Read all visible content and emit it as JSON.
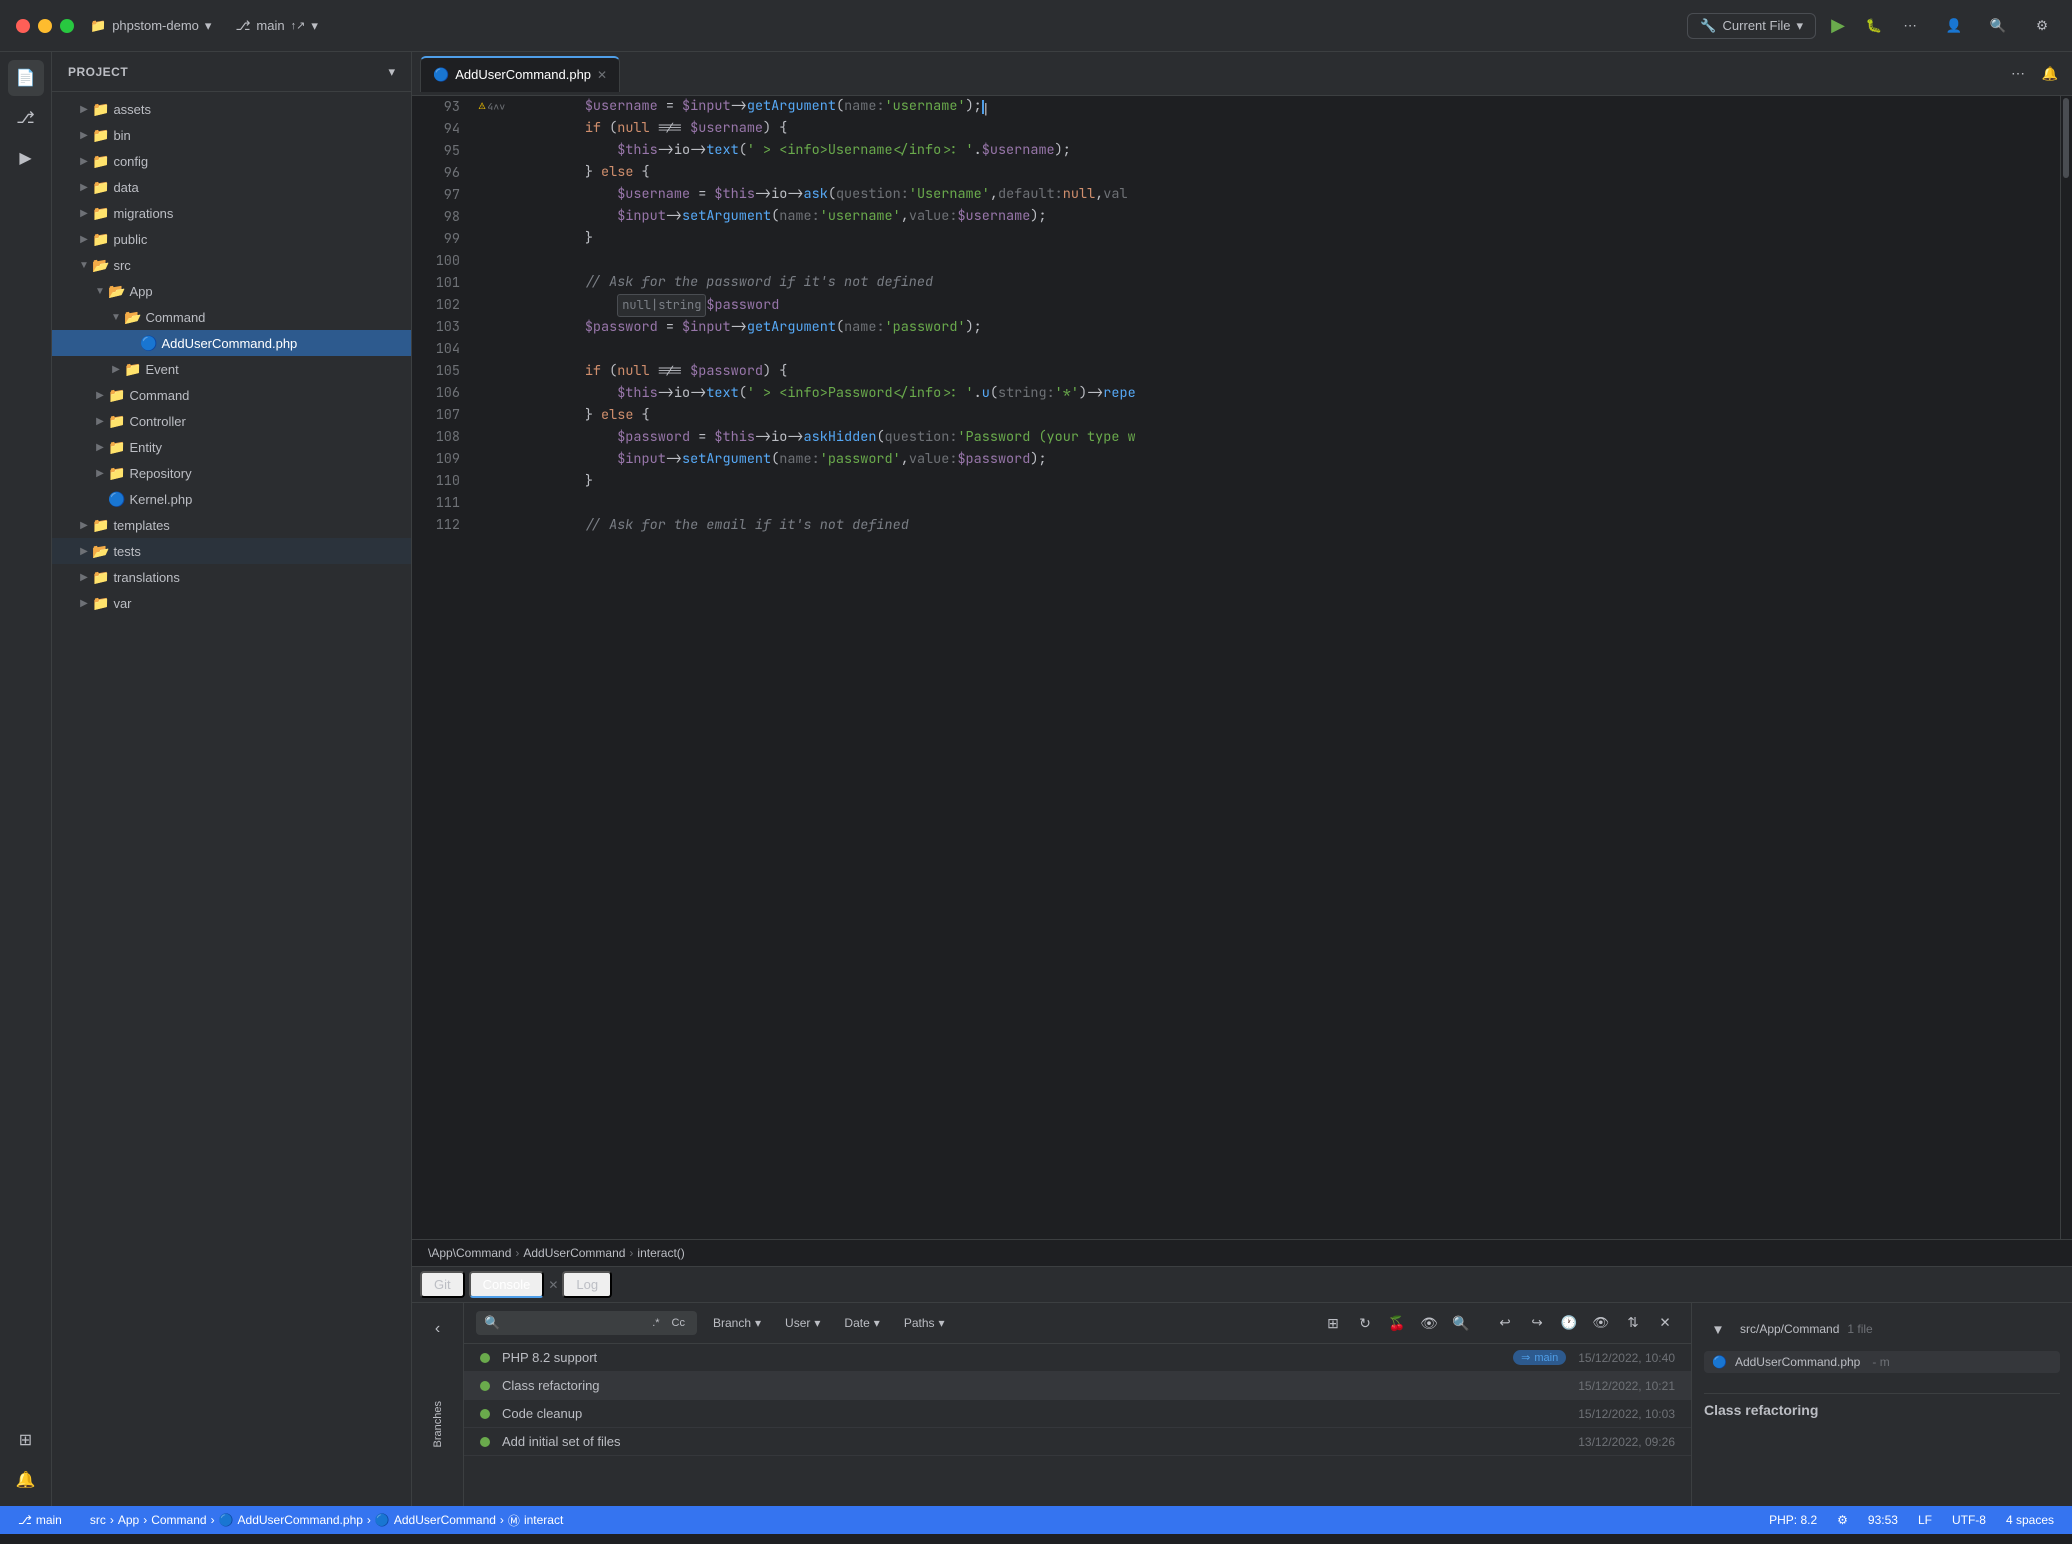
{
  "titlebar": {
    "traffic_close": "●",
    "traffic_min": "●",
    "traffic_max": "●",
    "project": "phpstom-demo",
    "branch": "main",
    "current_file_label": "Current File",
    "run_icon": "▶",
    "debug_icon": "🐞",
    "more_icon": "⋯",
    "user_icon": "👤",
    "search_icon": "🔍",
    "settings_icon": "⚙"
  },
  "sidebar": {
    "title": "Project",
    "items": [
      {
        "label": "assets",
        "type": "folder",
        "indent": 1,
        "expanded": false
      },
      {
        "label": "bin",
        "type": "folder",
        "indent": 1,
        "expanded": false
      },
      {
        "label": "config",
        "type": "folder",
        "indent": 1,
        "expanded": false
      },
      {
        "label": "data",
        "type": "folder",
        "indent": 1,
        "expanded": false
      },
      {
        "label": "migrations",
        "type": "folder",
        "indent": 1,
        "expanded": false
      },
      {
        "label": "public",
        "type": "folder",
        "indent": 1,
        "expanded": false
      },
      {
        "label": "src",
        "type": "folder",
        "indent": 1,
        "expanded": true
      },
      {
        "label": "App",
        "type": "folder",
        "indent": 2,
        "expanded": true
      },
      {
        "label": "Command",
        "type": "folder",
        "indent": 3,
        "expanded": true
      },
      {
        "label": "AddUserCommand.php",
        "type": "file-php2",
        "indent": 4,
        "expanded": false,
        "selected": true
      },
      {
        "label": "Event",
        "type": "folder",
        "indent": 3,
        "expanded": false
      },
      {
        "label": "Command",
        "type": "folder",
        "indent": 2,
        "expanded": false
      },
      {
        "label": "Controller",
        "type": "folder",
        "indent": 2,
        "expanded": false
      },
      {
        "label": "Entity",
        "type": "folder",
        "indent": 2,
        "expanded": false
      },
      {
        "label": "Repository",
        "type": "folder",
        "indent": 2,
        "expanded": false
      },
      {
        "label": "Kernel.php",
        "type": "file-php",
        "indent": 2,
        "expanded": false
      },
      {
        "label": "templates",
        "type": "folder",
        "indent": 1,
        "expanded": false
      },
      {
        "label": "tests",
        "type": "folder",
        "indent": 1,
        "expanded": false
      },
      {
        "label": "translations",
        "type": "folder",
        "indent": 1,
        "expanded": false
      },
      {
        "label": "var",
        "type": "folder",
        "indent": 1,
        "expanded": false
      }
    ]
  },
  "editor": {
    "tab_label": "AddUserCommand.php",
    "lines": [
      {
        "num": 93,
        "content": "        $username = $input->getArgument( name: 'username');|"
      },
      {
        "num": 94,
        "content": "        if (null !== $username) {"
      },
      {
        "num": 95,
        "content": "            $this->io->text(' > <info>Username</info>: '.$username);"
      },
      {
        "num": 96,
        "content": "        } else {"
      },
      {
        "num": 97,
        "content": "            $username = $this->io->ask( question: 'Username',  default: null,  val"
      },
      {
        "num": 98,
        "content": "            $input->setArgument( name: 'username',  value: $username);"
      },
      {
        "num": 99,
        "content": "        }"
      },
      {
        "num": 100,
        "content": ""
      },
      {
        "num": 101,
        "content": "        // Ask for the password if it's not defined"
      },
      {
        "num": 102,
        "content": "            null|string $password"
      },
      {
        "num": 103,
        "content": "        $password = $input->getArgument( name: 'password');"
      },
      {
        "num": 104,
        "content": ""
      },
      {
        "num": 105,
        "content": "        if (null !== $password) {"
      },
      {
        "num": 106,
        "content": "            $this->io->text(' > <info>Password</info>: '.u( string: '*')->repe"
      },
      {
        "num": 107,
        "content": "        } else {"
      },
      {
        "num": 108,
        "content": "            $password = $this->io->askHidden( question: 'Password (your type w"
      },
      {
        "num": 109,
        "content": "            $input->setArgument( name: 'password',  value: $password);"
      },
      {
        "num": 110,
        "content": "        }"
      },
      {
        "num": 111,
        "content": ""
      },
      {
        "num": 112,
        "content": "        // Ask for the email if it's not defined"
      }
    ],
    "breadcrumb": [
      "\\App\\Command",
      "AddUserCommand",
      "interact()"
    ],
    "warning_count": "4"
  },
  "bottom_panel": {
    "tabs": [
      "Git",
      "Console",
      "Log"
    ],
    "active_tab": "Console",
    "git": {
      "search_placeholder": "🔍",
      "filters": [
        "Branch",
        "User",
        "Date",
        "Paths"
      ],
      "commits": [
        {
          "message": "PHP 8.2 support",
          "badge": "main",
          "date": "15/12/2022, 10:40",
          "dot_color": "#6aaa4c"
        },
        {
          "message": "Class refactoring",
          "date": "15/12/2022, 10:21",
          "dot_color": "#6aaa4c"
        },
        {
          "message": "Code cleanup",
          "date": "15/12/2022, 10:03",
          "dot_color": "#6aaa4c"
        },
        {
          "message": "Add initial set of files",
          "date": "13/12/2022, 09:26",
          "dot_color": "#6aaa4c"
        }
      ],
      "right_panel": {
        "file_section": "src/App/Command",
        "file_count": "1 file",
        "file_name": "AddUserCommand.php",
        "file_status": "- m",
        "commit_title": "Class refactoring"
      }
    }
  },
  "status_bar": {
    "branch": "main",
    "src_path": "src",
    "app_path": "App",
    "command_path": "Command",
    "file": "AddUserCommand.php",
    "class": "AddUserCommand",
    "method": "interact",
    "php_version": "PHP: 8.2",
    "line_ending": "LF",
    "encoding": "UTF-8",
    "indent": "4 spaces",
    "line_col": "93:53"
  }
}
